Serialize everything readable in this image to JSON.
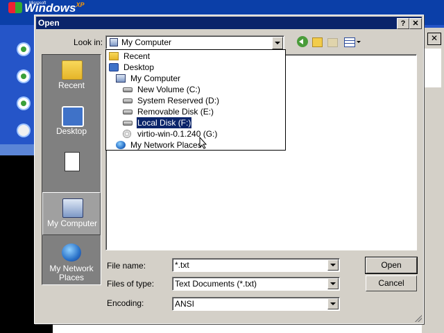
{
  "background": {
    "logo_small": "Microsoft",
    "logo_text": "Windows",
    "logo_xp": "XP",
    "close_glyph": "✕"
  },
  "dialog": {
    "title": "Open",
    "help_glyph": "?",
    "close_glyph": "✕",
    "look_in_label": "Look in:",
    "look_in_value": "My Computer",
    "places": [
      {
        "label": "Recent",
        "icon": "recent-folder-icon"
      },
      {
        "label": "Desktop",
        "icon": "desktop-icon"
      },
      {
        "label": "",
        "icon": "my-documents-icon"
      },
      {
        "label": "My Computer",
        "icon": "my-computer-icon"
      },
      {
        "label": "My Network Places",
        "icon": "network-places-icon"
      }
    ],
    "dropdown_items": [
      {
        "label": "Recent",
        "icon": "folder-icon"
      },
      {
        "label": "Desktop",
        "icon": "desktop-icon"
      },
      {
        "label": "My Computer",
        "icon": "computer-icon"
      },
      {
        "label": "New Volume (C:)",
        "icon": "drive-icon"
      },
      {
        "label": "System Reserved (D:)",
        "icon": "drive-icon"
      },
      {
        "label": "Removable Disk (E:)",
        "icon": "drive-icon"
      },
      {
        "label": "Local Disk (F:)",
        "icon": "drive-icon"
      },
      {
        "label": "virtio-win-0.1.240 (G:)",
        "icon": "cd-drive-icon"
      },
      {
        "label": "My Network Places",
        "icon": "network-icon"
      }
    ],
    "file_name_label": "File name:",
    "file_name_value": "*.txt",
    "files_of_type_label": "Files of type:",
    "files_of_type_value": "Text Documents (*.txt)",
    "encoding_label": "Encoding:",
    "encoding_value": "ANSI",
    "open_button": "Open",
    "cancel_button": "Cancel"
  }
}
